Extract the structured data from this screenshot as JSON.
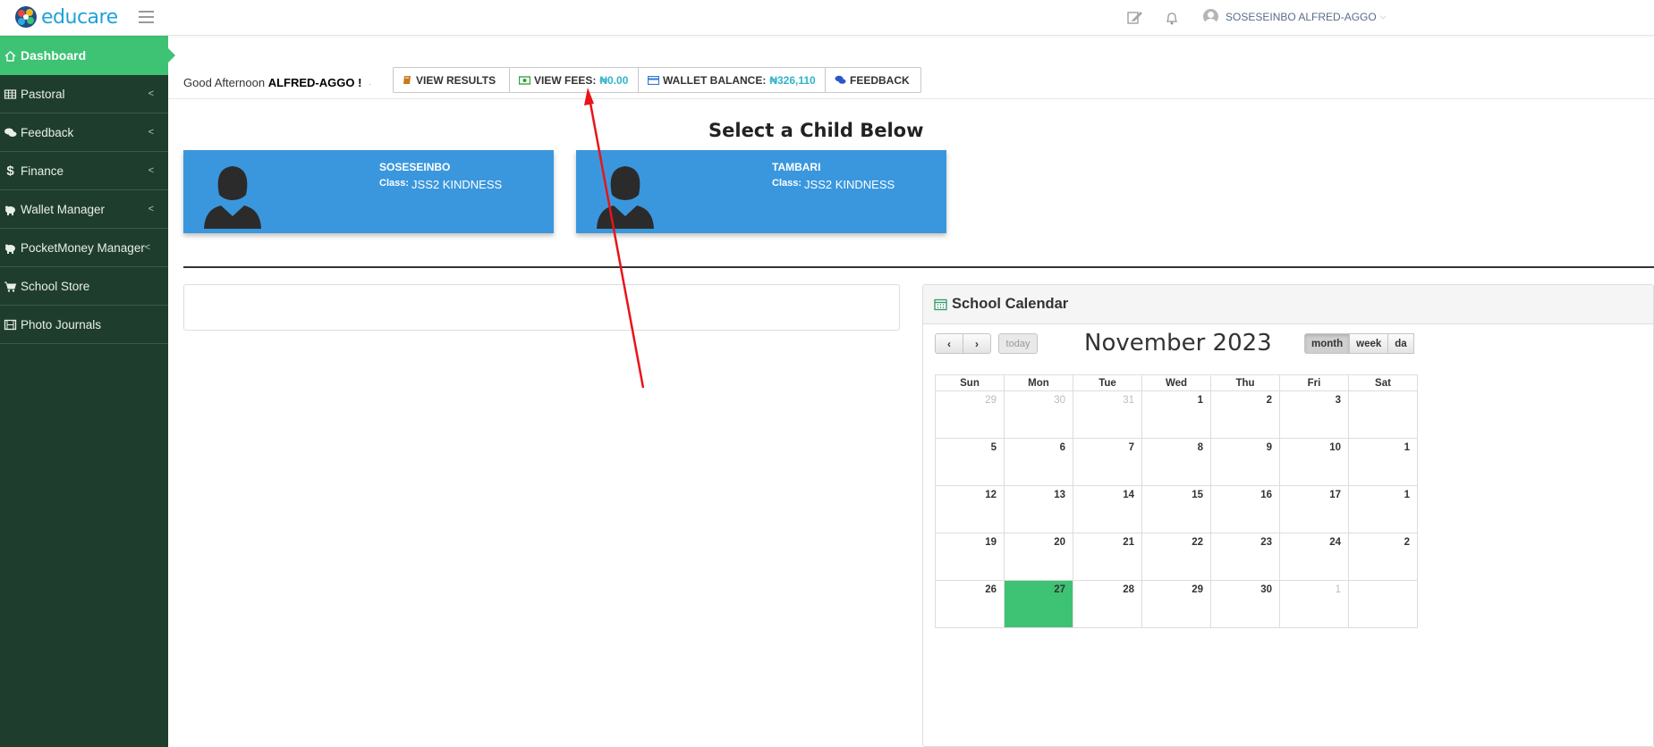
{
  "brand": {
    "name": "educare"
  },
  "header": {
    "user_name": "SOSESEINBO ALFRED-AGGO"
  },
  "sidebar": {
    "items": [
      {
        "label": "Dashboard"
      },
      {
        "label": "Pastoral"
      },
      {
        "label": "Feedback"
      },
      {
        "label": "Finance"
      },
      {
        "label": "Wallet Manager"
      },
      {
        "label": "PocketMoney Manager"
      },
      {
        "label": "School Store"
      },
      {
        "label": "Photo Journals"
      }
    ]
  },
  "greeting": {
    "prefix": "Good Afternoon",
    "name": "ALFRED-AGGO !",
    "suffix": "·"
  },
  "actions": {
    "view_results": "VIEW RESULTS",
    "view_fees": "VIEW FEES:",
    "fees_value": "₦0.00",
    "wallet_balance": "WALLET BALANCE:",
    "wallet_value": "₦326,110",
    "feedback": "FEEDBACK"
  },
  "children": {
    "title": "Select a Child Below",
    "class_label": "Class:",
    "list": [
      {
        "name": "SOSESEINBO",
        "class": "JSS2 KINDNESS"
      },
      {
        "name": "TAMBARI",
        "class": "JSS2 KINDNESS"
      }
    ]
  },
  "calendar": {
    "panel_title": "School Calendar",
    "month_title": "November 2023",
    "prev": "‹",
    "next": "›",
    "today": "today",
    "views": [
      "month",
      "week",
      "da"
    ],
    "weekdays": [
      "Sun",
      "Mon",
      "Tue",
      "Wed",
      "Thu",
      "Fri",
      "Sat"
    ],
    "weeks": [
      [
        "29",
        "30",
        "31",
        "1",
        "2",
        "3",
        ""
      ],
      [
        "5",
        "6",
        "7",
        "8",
        "9",
        "10",
        "1"
      ],
      [
        "12",
        "13",
        "14",
        "15",
        "16",
        "17",
        "1"
      ],
      [
        "19",
        "20",
        "21",
        "22",
        "23",
        "24",
        "2"
      ],
      [
        "26",
        "27",
        "28",
        "29",
        "30",
        "1",
        ""
      ]
    ]
  },
  "colors": {
    "sidebar_bg": "#1f3d2c",
    "accent_green": "#3ec274",
    "card_blue": "#3a97dd",
    "value_teal": "#30b4c8",
    "annotation_red": "#e8141a"
  }
}
